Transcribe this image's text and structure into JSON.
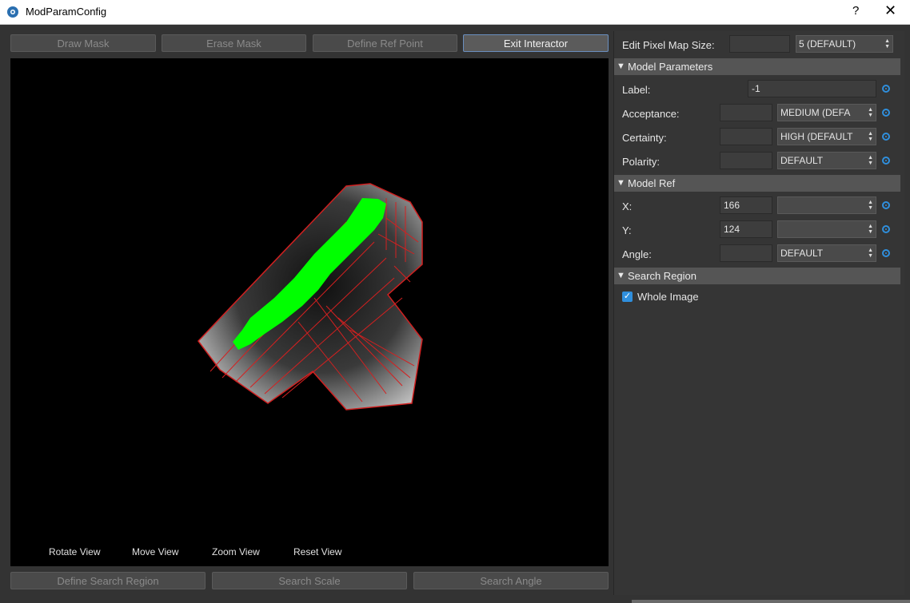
{
  "window": {
    "title": "ModParamConfig",
    "help_glyph": "?",
    "close_glyph": "✕"
  },
  "toolbar": {
    "draw_mask": "Draw Mask",
    "erase_mask": "Erase Mask",
    "define_ref_point": "Define Ref Point",
    "exit_interactor": "Exit Interactor"
  },
  "view": {
    "rotate": "Rotate View",
    "move": "Move View",
    "zoom": "Zoom View",
    "reset": "Reset View"
  },
  "bottom": {
    "define_search_region": "Define Search Region",
    "search_scale": "Search Scale",
    "search_angle": "Search Angle"
  },
  "panel": {
    "pixel_map": {
      "label": "Edit Pixel Map Size:",
      "value": "",
      "select": "5 (DEFAULT)"
    },
    "model_parameters": {
      "title": "Model Parameters",
      "label": {
        "label": "Label:",
        "value": "-1"
      },
      "acceptance": {
        "label": "Acceptance:",
        "value": "",
        "select": "MEDIUM (DEFA"
      },
      "certainty": {
        "label": "Certainty:",
        "value": "",
        "select": "HIGH (DEFAULT"
      },
      "polarity": {
        "label": "Polarity:",
        "value": "",
        "select": "DEFAULT"
      }
    },
    "model_ref": {
      "title": "Model Ref",
      "x": {
        "label": "X:",
        "value": "166",
        "select": ""
      },
      "y": {
        "label": "Y:",
        "value": "124",
        "select": ""
      },
      "angle": {
        "label": "Angle:",
        "value": "",
        "select": "DEFAULT"
      }
    },
    "search_region": {
      "title": "Search Region",
      "whole_image": {
        "label": "Whole Image",
        "checked": true
      }
    }
  },
  "colors": {
    "accent": "#2f8fdd",
    "mask": "#00ff00",
    "edges": "#e02020"
  }
}
